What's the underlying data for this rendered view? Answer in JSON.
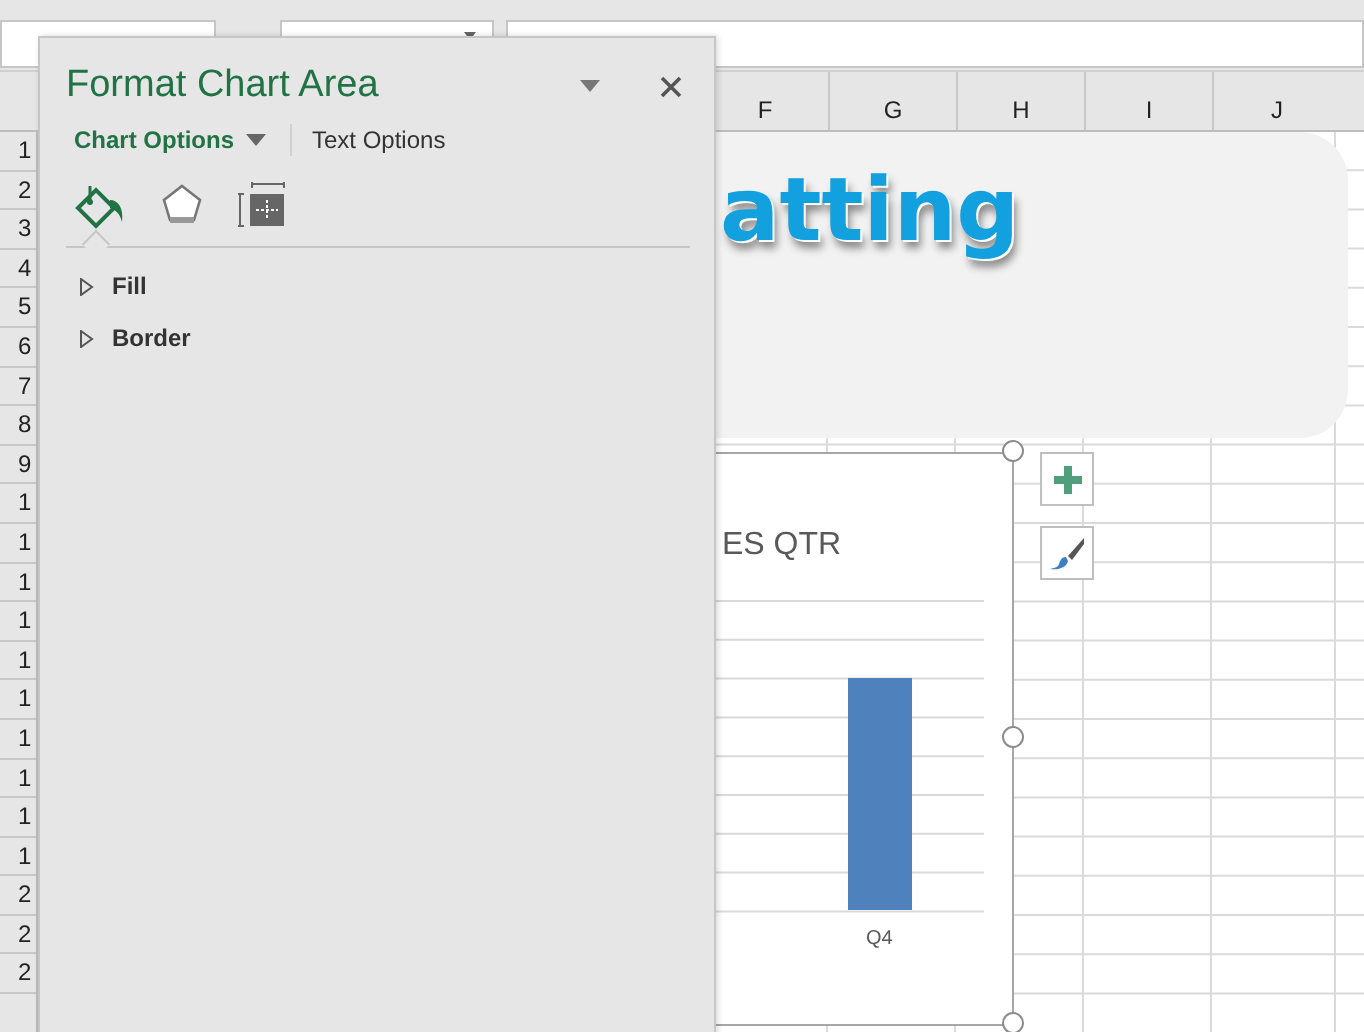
{
  "sheet": {
    "columns": [
      "F",
      "G",
      "H",
      "I",
      "J"
    ],
    "rows": [
      "1",
      "2",
      "3",
      "4",
      "5",
      "6",
      "7",
      "8",
      "9",
      "1",
      "1",
      "1",
      "1",
      "1",
      "1",
      "1",
      "1",
      "1",
      "1",
      "2",
      "2",
      "2"
    ]
  },
  "banner": {
    "text": "atting"
  },
  "chart": {
    "title": "ES QTR",
    "category": "Q4",
    "selected": true
  },
  "pane": {
    "title": "Format Chart Area",
    "tabs": [
      {
        "label": "Chart Options",
        "selected": true
      },
      {
        "label": "Text Options",
        "selected": false
      }
    ],
    "icon_tabs": [
      {
        "kind": "fill",
        "selected": true
      },
      {
        "kind": "effects",
        "selected": false
      },
      {
        "kind": "size",
        "selected": false
      }
    ],
    "sections": [
      {
        "label": "Fill",
        "expanded": false
      },
      {
        "label": "Border",
        "expanded": false
      }
    ]
  }
}
